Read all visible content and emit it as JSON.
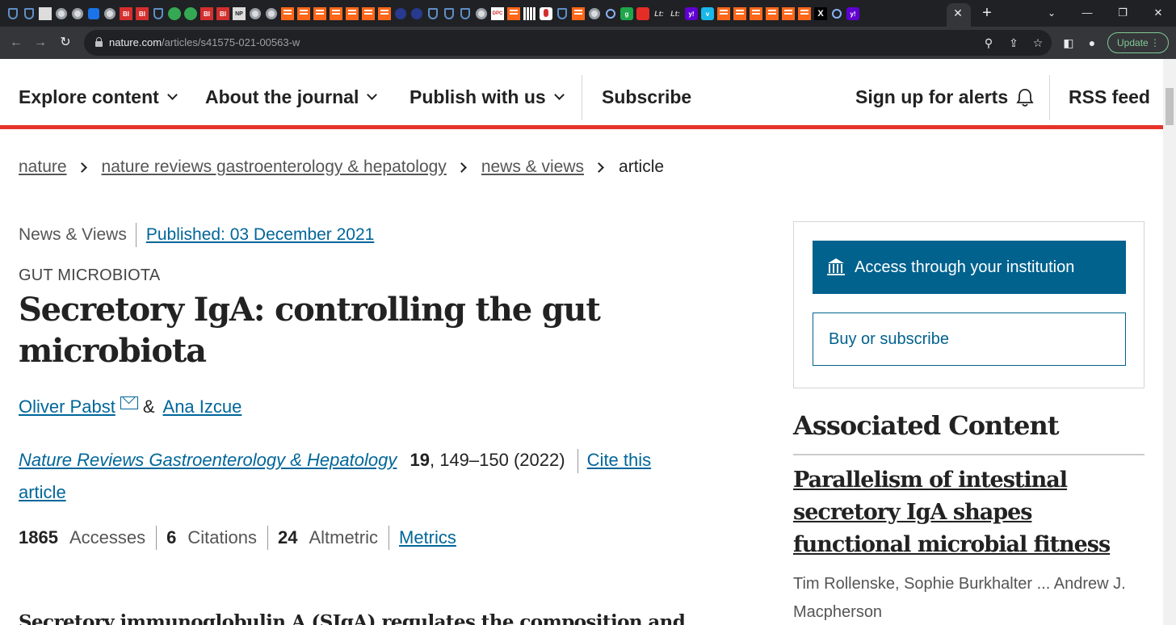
{
  "browser": {
    "tab_close": "✕",
    "new_tab": "+",
    "url_domain": "nature.com",
    "url_path": "/articles/s41575-021-00563-w",
    "update_label": "Update",
    "colors": {
      "frame": "#202124",
      "toolbar": "#35363a",
      "update": "#81c995"
    },
    "pinned_tab_icons": [
      "shield-icon",
      "shield-icon",
      "video-icon",
      "globe-icon",
      "globe-icon",
      "gem-icon",
      "globe-icon",
      "bi-icon",
      "bi-icon",
      "shield-icon",
      "play-icon",
      "play-icon",
      "bi-icon",
      "bi-icon",
      "news-icon",
      "globe-icon",
      "globe-icon",
      "substack-icon",
      "substack-icon",
      "substack-icon",
      "substack-icon",
      "substack-icon",
      "substack-icon",
      "substack-icon",
      "hex-icon",
      "hex-icon",
      "shield-icon",
      "shield-icon",
      "shield-icon",
      "globe-icon",
      "book-icon",
      "substack-icon",
      "piano-icon",
      "mic-icon",
      "shield-icon",
      "substack-icon",
      "globe-icon",
      "search-icon",
      "g-icon",
      "youtube-icon",
      "lt-icon",
      "lt-icon",
      "yahoo-icon",
      "vimeo-icon",
      "substack-icon",
      "substack-icon",
      "substack-icon",
      "substack-icon",
      "substack-icon",
      "substack-icon",
      "x-icon",
      "search-icon",
      "yahoo-icon"
    ],
    "tab_icon_labels": {
      "bi": "BI",
      "lt": "Lt:",
      "x": "X",
      "g": "g",
      "yahoo": "y!",
      "vimeo": "v",
      "book": "DPC",
      "news": "NP"
    }
  },
  "site_nav": {
    "items": [
      "Explore content",
      "About the journal",
      "Publish with us"
    ],
    "subscribe": "Subscribe",
    "alerts": "Sign up for alerts",
    "rss": "RSS feed",
    "accent": "#e6332a"
  },
  "breadcrumb": {
    "items": [
      "nature",
      "nature reviews gastroenterology & hepatology",
      "news & views"
    ],
    "current": "article"
  },
  "article": {
    "type": "News & Views",
    "published": "Published: 03 December 2021",
    "subject": "GUT MICROBIOTA",
    "title": "Secretory IgA: controlling the gut microbiota",
    "authors": [
      "Oliver Pabst",
      "Ana Izcue"
    ],
    "author_join": "&",
    "journal": "Nature Reviews Gastroenterology & Hepatology",
    "volume": "19",
    "pages_year": ", 149–150 (2022)",
    "cite": "Cite this article",
    "metrics": {
      "accesses_num": "1865",
      "accesses_label": "Accesses",
      "citations_num": "6",
      "citations_label": "Citations",
      "altmetric_num": "24",
      "altmetric_label": "Altmetric",
      "link": "Metrics"
    },
    "abstract_start": "Secretory immunoglobulin A (SIgA) regulates the composition and"
  },
  "sidebar": {
    "access_button": "Access through your institution",
    "buy_button": "Buy or subscribe",
    "access_color": "#01628e",
    "associated_heading": "Associated Content",
    "associated_title": "Parallelism of intestinal secretory IgA shapes functional microbial fitness",
    "associated_authors": "Tim Rollenske, Sophie Burkhalter ... Andrew J. Macpherson"
  }
}
